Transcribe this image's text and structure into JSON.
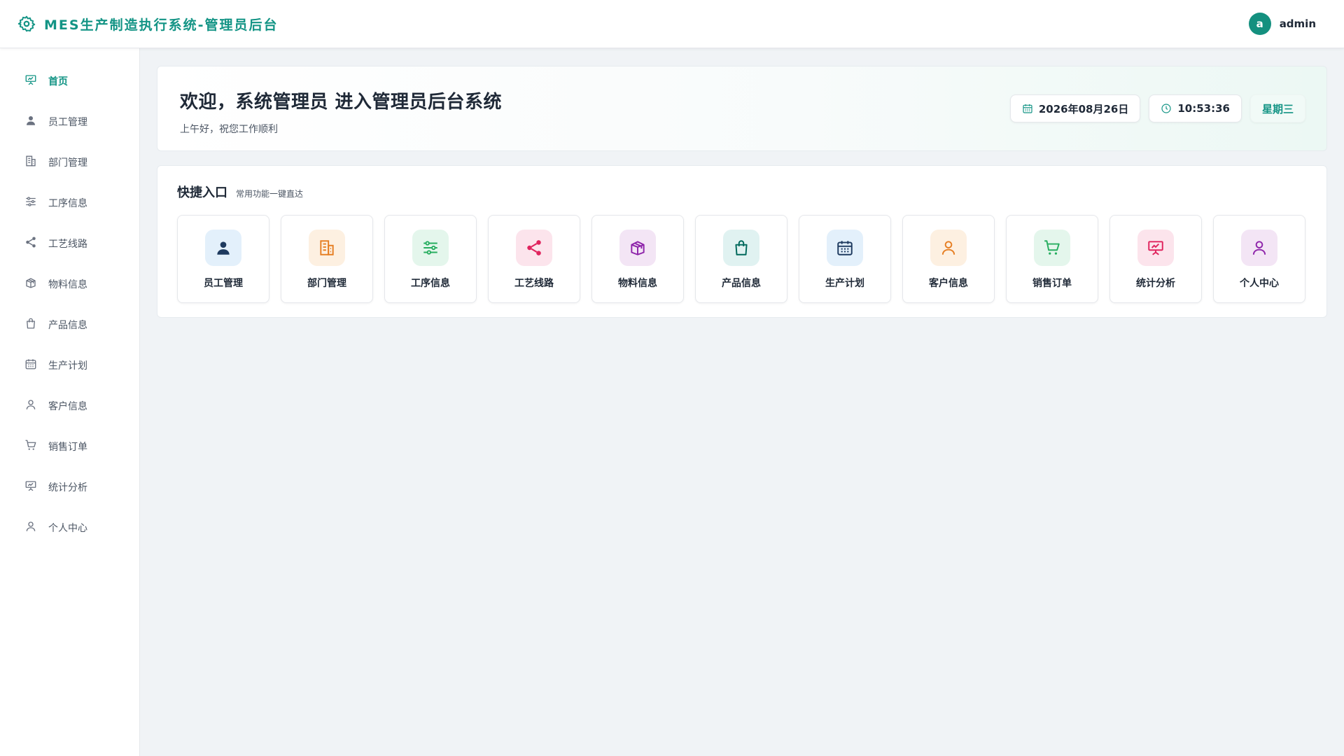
{
  "header": {
    "title": "MES生产制造执行系统-管理员后台",
    "icon": "gear-icon",
    "user": {
      "avatar_letter": "a",
      "name": "admin"
    }
  },
  "sidebar": {
    "items": [
      {
        "label": "首页",
        "icon": "presentation-icon",
        "active": true
      },
      {
        "label": "员工管理",
        "icon": "user-solid-icon"
      },
      {
        "label": "部门管理",
        "icon": "building-icon"
      },
      {
        "label": "工序信息",
        "icon": "sliders-icon"
      },
      {
        "label": "工艺线路",
        "icon": "share-icon"
      },
      {
        "label": "物料信息",
        "icon": "box-icon"
      },
      {
        "label": "产品信息",
        "icon": "shopping-bag-icon"
      },
      {
        "label": "生产计划",
        "icon": "calendar-icon"
      },
      {
        "label": "客户信息",
        "icon": "user-outline-icon"
      },
      {
        "label": "销售订单",
        "icon": "cart-icon"
      },
      {
        "label": "统计分析",
        "icon": "presentation-icon"
      },
      {
        "label": "个人中心",
        "icon": "user-outline-icon"
      }
    ]
  },
  "welcome": {
    "title": "欢迎，系统管理员 进入管理员后台系统",
    "subtitle": "上午好，祝您工作顺利",
    "date": "2026年08月26日",
    "time": "10:53:36",
    "weekday": "星期三"
  },
  "quick": {
    "title": "快捷入口",
    "subtitle": "常用功能一键直达",
    "cards": [
      {
        "label": "员工管理",
        "icon": "user-solid-icon",
        "color": "#1e3a5f",
        "bg": "#e3f0fb"
      },
      {
        "label": "部门管理",
        "icon": "building-icon",
        "color": "#e67e22",
        "bg": "#fdf0e1"
      },
      {
        "label": "工序信息",
        "icon": "sliders-icon",
        "color": "#27ae60",
        "bg": "#e4f6ec"
      },
      {
        "label": "工艺线路",
        "icon": "share-icon",
        "color": "#e0245e",
        "bg": "#fce4ec"
      },
      {
        "label": "物料信息",
        "icon": "box-icon",
        "color": "#8e24aa",
        "bg": "#f3e5f5"
      },
      {
        "label": "产品信息",
        "icon": "shopping-bag-icon",
        "color": "#00695c",
        "bg": "#e0f2f1"
      },
      {
        "label": "生产计划",
        "icon": "calendar-icon",
        "color": "#1e3a5f",
        "bg": "#e3f0fb"
      },
      {
        "label": "客户信息",
        "icon": "user-outline-icon",
        "color": "#e67e22",
        "bg": "#fdf0e1"
      },
      {
        "label": "销售订单",
        "icon": "cart-icon",
        "color": "#27ae60",
        "bg": "#e4f6ec"
      },
      {
        "label": "统计分析",
        "icon": "presentation-icon",
        "color": "#e0245e",
        "bg": "#fce4ec"
      },
      {
        "label": "个人中心",
        "icon": "user-outline-icon",
        "color": "#8e24aa",
        "bg": "#f3e5f5"
      }
    ]
  },
  "colors": {
    "accent": "#139485",
    "sidebar_icon": "#6b7280"
  }
}
